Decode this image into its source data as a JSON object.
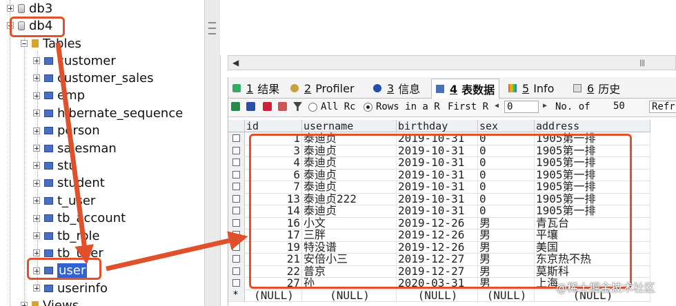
{
  "tree": {
    "db3_label": "db3",
    "db4_label": "db4",
    "tables_label": "Tables",
    "tables": [
      "customer",
      "customer_sales",
      "emp",
      "hibernate_sequence",
      "person",
      "salesman",
      "stu",
      "student",
      "t_user",
      "tb_account",
      "tb_role",
      "tb_user",
      "user",
      "userinfo"
    ],
    "selected_table": "user",
    "views_label": "Views"
  },
  "tabs": [
    {
      "num": "1",
      "label": "结果"
    },
    {
      "num": "2",
      "label": "Profiler"
    },
    {
      "num": "3",
      "label": "信息"
    },
    {
      "num": "4",
      "label": "表数据"
    },
    {
      "num": "5",
      "label": "Info"
    },
    {
      "num": "6",
      "label": "历史"
    }
  ],
  "active_tab": "4",
  "toolbar": {
    "all_rows_label": "All Rc",
    "rows_in_range_label": "Rows in a R",
    "first_label": "First R",
    "first_value": "0",
    "no_of_label": "No. of",
    "no_of_value": "50",
    "refresh_label": "Refr"
  },
  "grid": {
    "columns": [
      "id",
      "username",
      "birthday",
      "sex",
      "address"
    ],
    "rows": [
      [
        "1",
        "泰迪贞",
        "2019-10-31",
        "0",
        "1905第一排"
      ],
      [
        "3",
        "泰迪贞",
        "2019-10-31",
        "0",
        "1905第一排"
      ],
      [
        "4",
        "泰迪贞",
        "2019-10-31",
        "0",
        "1905第一排"
      ],
      [
        "6",
        "泰迪贞",
        "2019-10-31",
        "0",
        "1905第一排"
      ],
      [
        "7",
        "泰迪贞",
        "2019-10-31",
        "0",
        "1905第一排"
      ],
      [
        "13",
        "泰迪贞222",
        "2019-10-31",
        "0",
        "1905第一排"
      ],
      [
        "14",
        "泰迪贞",
        "2019-10-31",
        "0",
        "1905第一排"
      ],
      [
        "16",
        "小文",
        "2019-12-26",
        "男",
        "青瓦台"
      ],
      [
        "17",
        "三胖",
        "2019-12-26",
        "男",
        "平壤"
      ],
      [
        "19",
        "特没谱",
        "2019-12-26",
        "男",
        "美国"
      ],
      [
        "21",
        "安倍小三",
        "2019-12-27",
        "男",
        "东京热不热"
      ],
      [
        "22",
        "普京",
        "2019-12-27",
        "男",
        "莫斯科"
      ],
      [
        "27",
        "孙",
        "2020-03-31",
        "男",
        "上海"
      ]
    ],
    "new_row": [
      "(NULL)",
      "(NULL)",
      "(NULL)",
      "(NULL)",
      "(NULL)"
    ],
    "new_row_marker": "*"
  },
  "watermark": "@稀土掘金技术社区",
  "colors": {
    "annotation": "#e0502a",
    "selection": "#3062d0"
  }
}
